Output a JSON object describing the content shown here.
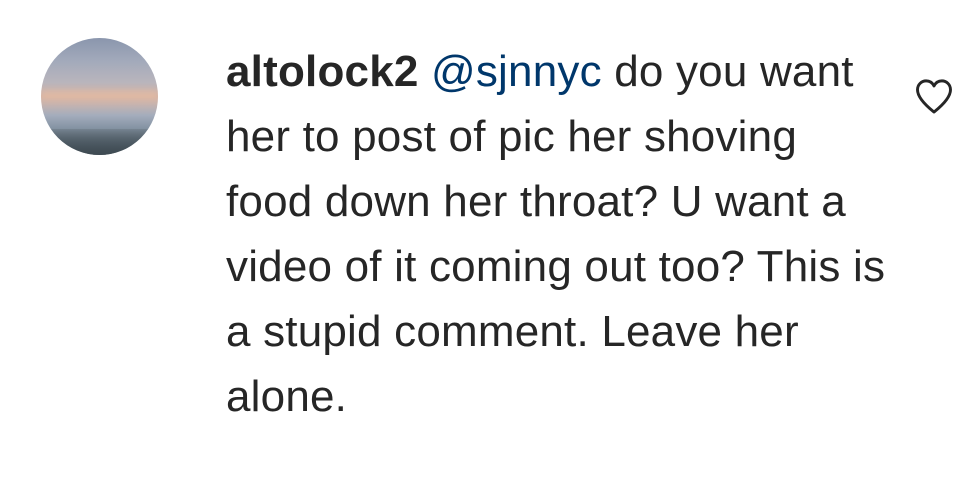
{
  "comment": {
    "username": "altolock2",
    "mention": "@sjnnyc",
    "text": "do you want her to post of pic her shoving food down her throat? U want a video of it coming out too? This is a stupid comment. Leave her alone.",
    "avatar_icon": "profile-photo",
    "like_icon": "heart-outline-icon",
    "colors": {
      "text": "#262626",
      "mention": "#00376b",
      "background": "#ffffff"
    }
  }
}
